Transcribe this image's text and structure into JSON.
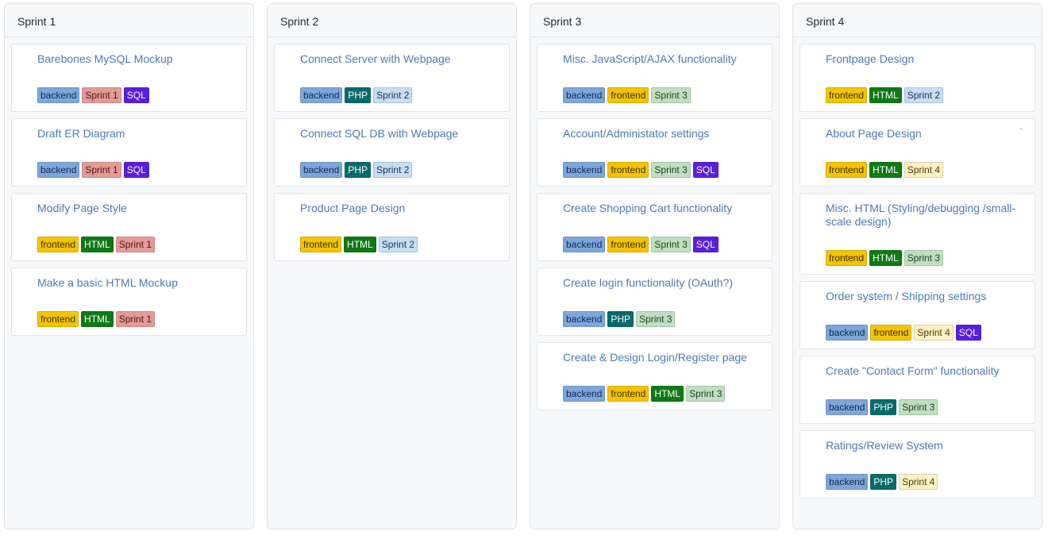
{
  "colors": {
    "backend": {
      "bg": "#7fa6dc",
      "fg": "#0b2a4a"
    },
    "frontend": {
      "bg": "#f5c400",
      "fg": "#3a2e00"
    },
    "HTML": {
      "bg": "#0f7a14",
      "fg": "#ffffff"
    },
    "PHP": {
      "bg": "#086b6b",
      "fg": "#ffffff"
    },
    "SQL": {
      "bg": "#5a1de0",
      "fg": "#ffffff"
    },
    "Sprint 1": {
      "bg": "#e59a97",
      "fg": "#4a1513"
    },
    "Sprint 2": {
      "bg": "#c5def5",
      "fg": "#1a3350"
    },
    "Sprint 3": {
      "bg": "#bfe0c0",
      "fg": "#1d4220"
    },
    "Sprint 4": {
      "bg": "#fdf1c4",
      "fg": "#4a3d08"
    }
  },
  "columns": [
    {
      "name": "Sprint 1",
      "cards": [
        {
          "title": "Barebones MySQL Mockup",
          "labels": [
            "backend",
            "Sprint 1",
            "SQL"
          ]
        },
        {
          "title": "Draft ER Diagram",
          "labels": [
            "backend",
            "Sprint 1",
            "SQL"
          ]
        },
        {
          "title": "Modify Page Style",
          "labels": [
            "frontend",
            "HTML",
            "Sprint 1"
          ]
        },
        {
          "title": "Make a basic HTML Mockup",
          "labels": [
            "frontend",
            "HTML",
            "Sprint 1"
          ]
        }
      ]
    },
    {
      "name": "Sprint 2",
      "cards": [
        {
          "title": "Connect Server with Webpage",
          "labels": [
            "backend",
            "PHP",
            "Sprint 2"
          ]
        },
        {
          "title": "Connect SQL DB with Webpage",
          "labels": [
            "backend",
            "PHP",
            "Sprint 2"
          ]
        },
        {
          "title": "Product Page Design",
          "labels": [
            "frontend",
            "HTML",
            "Sprint 2"
          ]
        }
      ]
    },
    {
      "name": "Sprint 3",
      "cards": [
        {
          "title": "Misc. JavaScript/AJAX functionality",
          "labels": [
            "backend",
            "frontend",
            "Sprint 3"
          ]
        },
        {
          "title": "Account/Administator settings",
          "labels": [
            "backend",
            "frontend",
            "Sprint 3",
            "SQL"
          ]
        },
        {
          "title": "Create Shopping Cart functionality",
          "labels": [
            "backend",
            "frontend",
            "Sprint 3",
            "SQL"
          ]
        },
        {
          "title": "Create login functionality (OAuth?)",
          "labels": [
            "backend",
            "PHP",
            "Sprint 3"
          ]
        },
        {
          "title": "Create & Design Login/Register page",
          "labels": [
            "backend",
            "frontend",
            "HTML",
            "Sprint 3"
          ]
        }
      ]
    },
    {
      "name": "Sprint 4",
      "cards": [
        {
          "title": "Frontpage Design",
          "labels": [
            "frontend",
            "HTML",
            "Sprint 2"
          ]
        },
        {
          "title": "About Page Design",
          "labels": [
            "frontend",
            "HTML",
            "Sprint 4"
          ],
          "dot": true
        },
        {
          "title": "Misc. HTML (Styling/debugging /small-scale design)",
          "labels": [
            "frontend",
            "HTML",
            "Sprint 3"
          ]
        },
        {
          "title": "Order system / Shipping settings",
          "labels": [
            "backend",
            "frontend",
            "Sprint 4",
            "SQL"
          ]
        },
        {
          "title": "Create \"Contact Form\" functionality",
          "labels": [
            "backend",
            "PHP",
            "Sprint 3"
          ]
        },
        {
          "title": "Ratings/Review System",
          "labels": [
            "backend",
            "PHP",
            "Sprint 4"
          ]
        }
      ]
    }
  ]
}
